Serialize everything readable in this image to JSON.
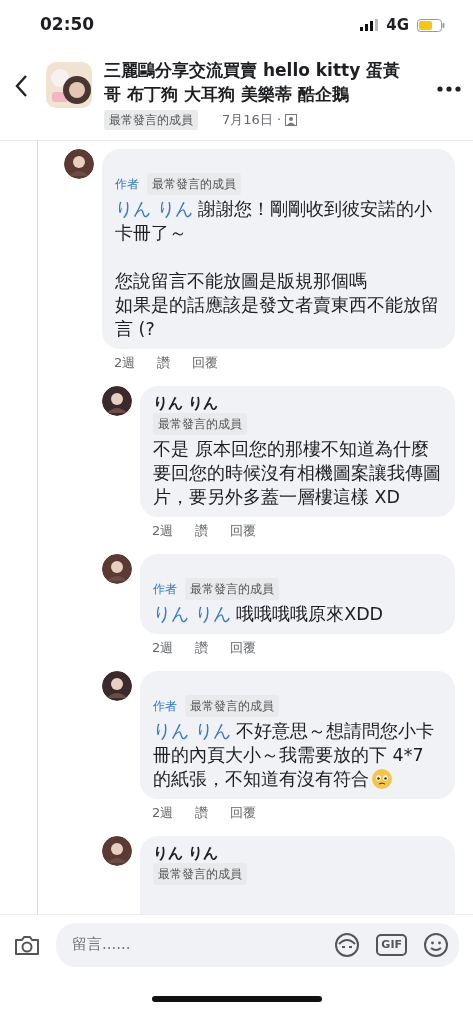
{
  "status_bar": {
    "time": "02:50",
    "network": "4G"
  },
  "header": {
    "title": "三麗鷗分享交流買賣 hello kitty 蛋黃哥 布丁狗 大耳狗 美樂蒂 酷企鵝",
    "badge": "最常發言的成員",
    "date": "7月16日 ·"
  },
  "comments": [
    {
      "badges": [
        {
          "kind": "author",
          "label": "作者"
        },
        {
          "kind": "member",
          "label": "最常發言的成員"
        }
      ],
      "mention": "りん りん",
      "paragraphs": [
        [
          "謝謝您！剛剛收到彼安諾的小卡冊了～"
        ],
        [
          "您說留言不能放圖是版規那個嗎",
          "如果是的話應該是發文者賣東西不能放留言 (?"
        ]
      ],
      "time": "2週",
      "actions": [
        "讚",
        "回覆"
      ],
      "children": [
        {
          "author": "りん りん",
          "badges": [
            {
              "kind": "member",
              "label": "最常發言的成員"
            }
          ],
          "paragraphs": [
            [
              "不是 原本回您的那樓不知道為什麼要回您的時候沒有相機圖案讓我傳圖片，要另外多蓋一層樓這樣 XD"
            ]
          ],
          "time": "2週",
          "actions": [
            "讚",
            "回覆"
          ]
        },
        {
          "badges": [
            {
              "kind": "author",
              "label": "作者"
            },
            {
              "kind": "member",
              "label": "最常發言的成員"
            }
          ],
          "mention": "りん りん",
          "paragraphs": [
            [
              "哦哦哦哦原來XDD"
            ]
          ],
          "time": "2週",
          "actions": [
            "讚",
            "回覆"
          ]
        },
        {
          "badges": [
            {
              "kind": "author",
              "label": "作者"
            },
            {
              "kind": "member",
              "label": "最常發言的成員"
            }
          ],
          "mention": "りん りん",
          "paragraphs": [
            [
              "不好意思～想請問您小卡冊的內頁大小～我需要放的下 4*7的紙張，不知道有沒有符合"
            ]
          ],
          "emoji": true,
          "time": "2週",
          "actions": [
            "讚",
            "回覆"
          ]
        },
        {
          "author": "りん りん",
          "badges": [
            {
              "kind": "member",
              "label": "最常發言的成員"
            }
          ]
        }
      ]
    }
  ],
  "composer": {
    "placeholder": "留言......",
    "gif_label": "GIF"
  }
}
